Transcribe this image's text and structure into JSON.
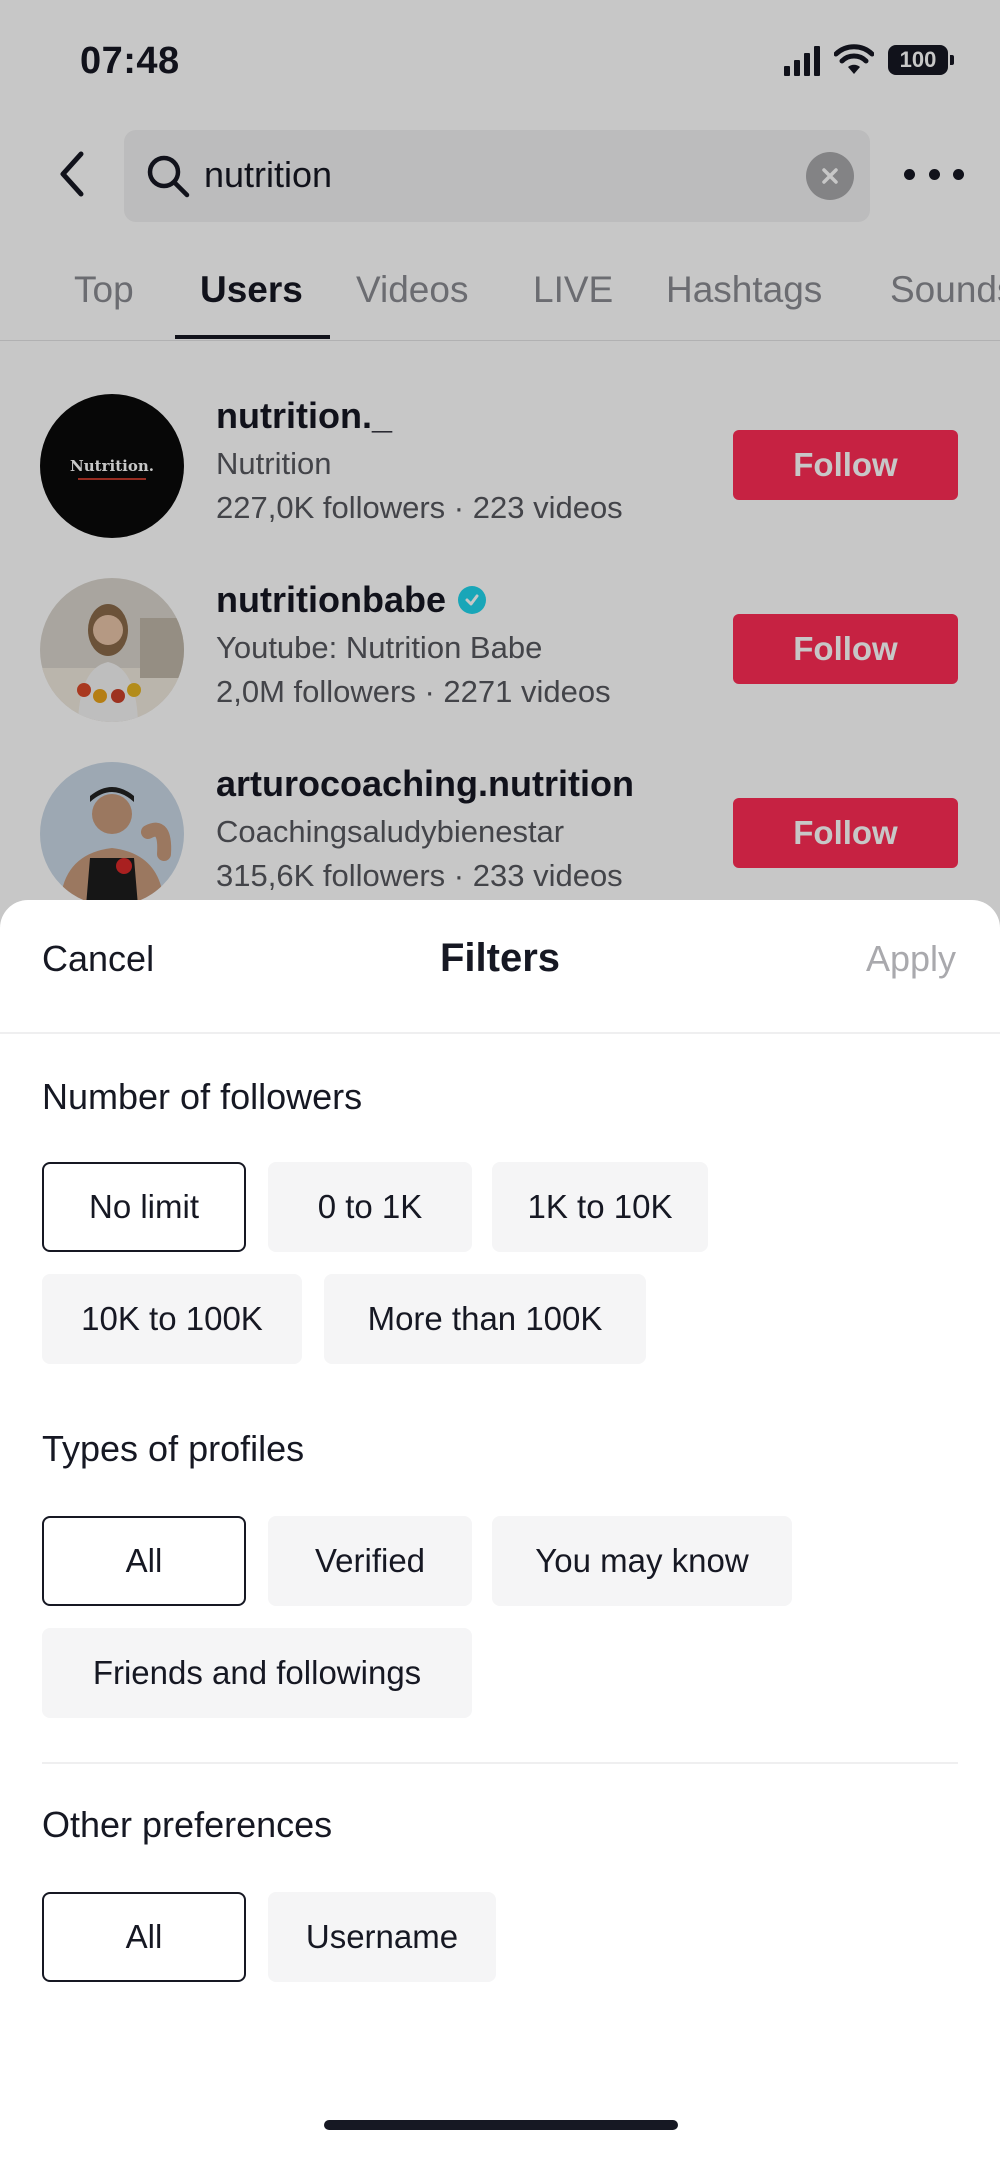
{
  "status_bar": {
    "time": "07:48",
    "battery": "100"
  },
  "search": {
    "query": "nutrition"
  },
  "tabs": [
    {
      "label": "Top",
      "active": false
    },
    {
      "label": "Users",
      "active": true
    },
    {
      "label": "Videos",
      "active": false
    },
    {
      "label": "LIVE",
      "active": false
    },
    {
      "label": "Hashtags",
      "active": false
    },
    {
      "label": "Sounds",
      "active": false
    }
  ],
  "users": [
    {
      "username": "nutrition._",
      "verified": false,
      "description": "Nutrition",
      "stats": "227,0K followers · 223 videos",
      "follow_label": "Follow",
      "avatar_text": "Nutrition."
    },
    {
      "username": "nutritionbabe",
      "verified": true,
      "description": "Youtube: Nutrition Babe",
      "stats": "2,0M followers · 2271 videos",
      "follow_label": "Follow"
    },
    {
      "username": "arturocoaching.nutrition",
      "verified": false,
      "description": "Coachingsaludybienestar",
      "stats": "315,6K followers · 233 videos",
      "follow_label": "Follow"
    }
  ],
  "filters": {
    "cancel_label": "Cancel",
    "title": "Filters",
    "apply_label": "Apply",
    "followers": {
      "title": "Number of followers",
      "options": [
        "No limit",
        "0 to 1K",
        "1K to 10K",
        "10K to 100K",
        "More than 100K"
      ],
      "selected": "No limit"
    },
    "profile_types": {
      "title": "Types of profiles",
      "options": [
        "All",
        "Verified",
        "You may know",
        "Friends and followings"
      ],
      "selected": "All"
    },
    "other": {
      "title": "Other preferences",
      "options": [
        "All",
        "Username"
      ],
      "selected": "All"
    }
  },
  "colors": {
    "follow_red": "#fe2c55",
    "verified_cyan": "#20d5ec",
    "apply_disabled": "#a9a9ad"
  }
}
